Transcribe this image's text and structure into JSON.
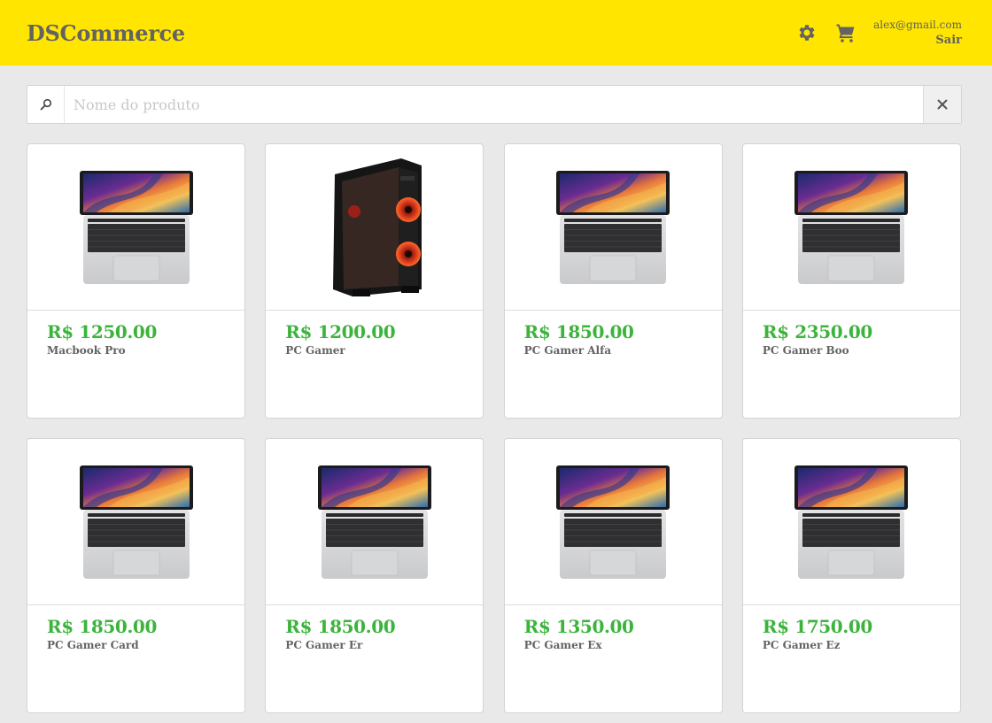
{
  "header": {
    "brand": "DSCommerce",
    "user_email": "alex@gmail.com",
    "logout_label": "Sair",
    "background": "#ffe500"
  },
  "search": {
    "placeholder": "Nome do produto",
    "value": ""
  },
  "colors": {
    "price": "#3cb43c",
    "text": "#636363",
    "background": "#e9e9e9"
  },
  "products": [
    {
      "price": "R$ 1250.00",
      "name": "Macbook Pro",
      "image": "laptop-image"
    },
    {
      "price": "R$ 1200.00",
      "name": "PC Gamer",
      "image": "pc-case-image"
    },
    {
      "price": "R$ 1850.00",
      "name": "PC Gamer Alfa",
      "image": "laptop-image"
    },
    {
      "price": "R$ 2350.00",
      "name": "PC Gamer Boo",
      "image": "laptop-image"
    },
    {
      "price": "R$ 1850.00",
      "name": "PC Gamer Card",
      "image": "laptop-image"
    },
    {
      "price": "R$ 1850.00",
      "name": "PC Gamer Er",
      "image": "laptop-image"
    },
    {
      "price": "R$ 1350.00",
      "name": "PC Gamer Ex",
      "image": "laptop-image"
    },
    {
      "price": "R$ 1750.00",
      "name": "PC Gamer Ez",
      "image": "laptop-image"
    }
  ]
}
